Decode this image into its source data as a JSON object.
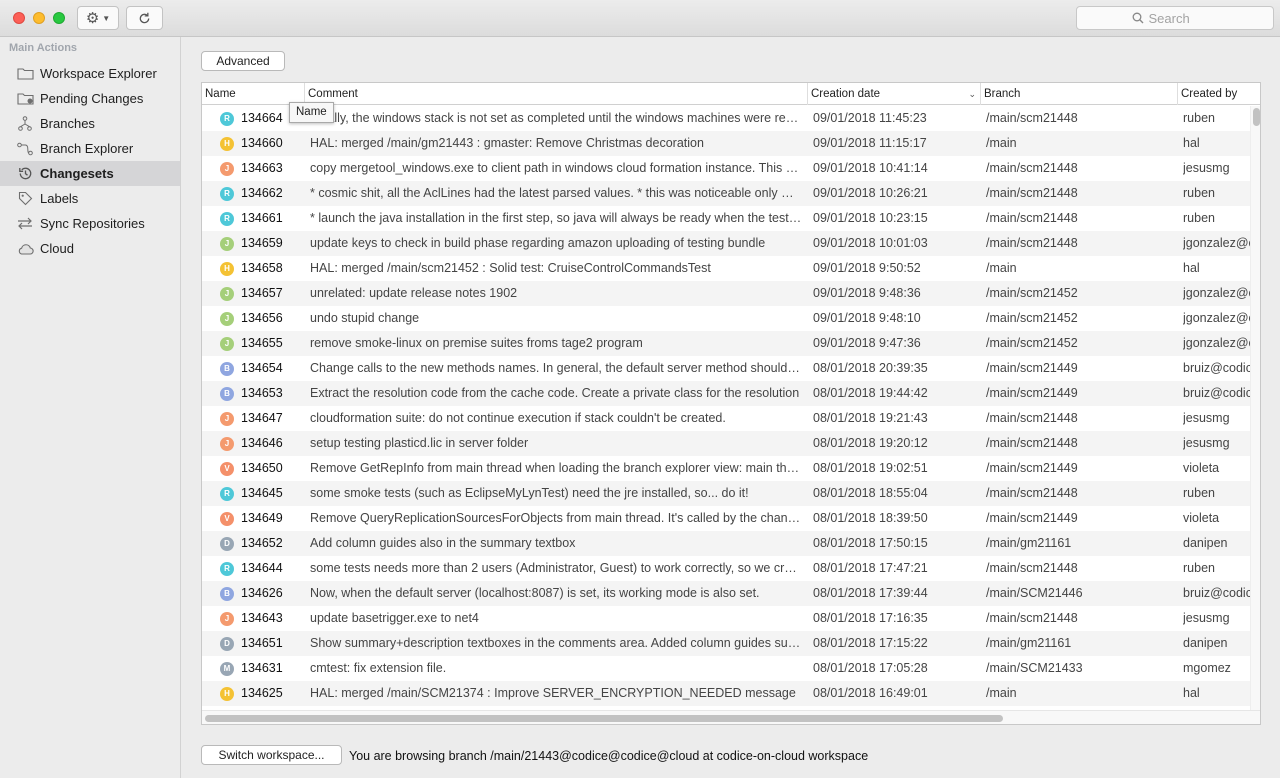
{
  "toolbar": {
    "search_placeholder": "Search",
    "gear_icon": "gear-icon",
    "refresh_icon": "refresh-icon"
  },
  "sidebar": {
    "header": "Main Actions",
    "items": [
      {
        "label": "Workspace Explorer",
        "icon": "folder-icon",
        "selected": false
      },
      {
        "label": "Pending Changes",
        "icon": "pending-folder-icon",
        "selected": false
      },
      {
        "label": "Branches",
        "icon": "branches-icon",
        "selected": false
      },
      {
        "label": "Branch Explorer",
        "icon": "branch-explorer-icon",
        "selected": false
      },
      {
        "label": "Changesets",
        "icon": "history-icon",
        "selected": true
      },
      {
        "label": "Labels",
        "icon": "tag-icon",
        "selected": false
      },
      {
        "label": "Sync Repositories",
        "icon": "sync-icon",
        "selected": false
      },
      {
        "label": "Cloud",
        "icon": "cloud-icon",
        "selected": false
      }
    ]
  },
  "main": {
    "advanced_label": "Advanced",
    "switch_label": "Switch workspace...",
    "status": "You are browsing branch /main/21443@codice@codice@cloud at codice-on-cloud workspace",
    "tooltip": "Name",
    "columns": [
      "Name",
      "Comment",
      "Creation date",
      "Branch",
      "Created by"
    ],
    "rows": [
      {
        "initial": "R",
        "color": "#4ec8d8",
        "id": "134664",
        "comment": "Finally, the windows stack is not set as completed until the windows machines were ready",
        "date": "09/01/2018 11:45:23",
        "branch": "/main/scm21448",
        "author": "ruben"
      },
      {
        "initial": "H",
        "color": "#f4c234",
        "id": "134660",
        "comment": "HAL: merged /main/gm21443 : gmaster: Remove Christmas decoration",
        "date": "09/01/2018 11:15:17",
        "branch": "/main",
        "author": "hal"
      },
      {
        "initial": "J",
        "color": "#f49a6e",
        "id": "134663",
        "comment": "copy mergetool_windows.exe to client path in windows cloud formation instance. This way",
        "date": "09/01/2018 10:41:14",
        "branch": "/main/scm21448",
        "author": "jesusmg"
      },
      {
        "initial": "R",
        "color": "#4ec8d8",
        "id": "134662",
        "comment": "* cosmic shit, all the AclLines had the latest parsed values. * this was  noticeable only when",
        "date": "09/01/2018 10:26:21",
        "branch": "/main/scm21448",
        "author": "ruben"
      },
      {
        "initial": "R",
        "color": "#4ec8d8",
        "id": "134661",
        "comment": "* launch the java installation in the first step, so java will always be ready when the tests start",
        "date": "09/01/2018 10:23:15",
        "branch": "/main/scm21448",
        "author": "ruben"
      },
      {
        "initial": "J",
        "color": "#a5cf7a",
        "id": "134659",
        "comment": "update keys to check in build phase regarding amazon uploading of testing bundle",
        "date": "09/01/2018 10:01:03",
        "branch": "/main/scm21448",
        "author": "jgonzalez@codice"
      },
      {
        "initial": "H",
        "color": "#f4c234",
        "id": "134658",
        "comment": "HAL: merged /main/scm21452 : Solid test: CruiseControlCommandsTest",
        "date": "09/01/2018 9:50:52",
        "branch": "/main",
        "author": "hal"
      },
      {
        "initial": "J",
        "color": "#a5cf7a",
        "id": "134657",
        "comment": "unrelated: update release notes 1902",
        "date": "09/01/2018 9:48:36",
        "branch": "/main/scm21452",
        "author": "jgonzalez@codice"
      },
      {
        "initial": "J",
        "color": "#a5cf7a",
        "id": "134656",
        "comment": "undo stupid change",
        "date": "09/01/2018 9:48:10",
        "branch": "/main/scm21452",
        "author": "jgonzalez@codice"
      },
      {
        "initial": "J",
        "color": "#a5cf7a",
        "id": "134655",
        "comment": "remove smoke-linux on premise suites froms tage2 program",
        "date": "09/01/2018 9:47:36",
        "branch": "/main/scm21452",
        "author": "jgonzalez@codice"
      },
      {
        "initial": "B",
        "color": "#8fa6e0",
        "id": "134654",
        "comment": "Change calls to the new methods names.  In general, the default server method should be used",
        "date": "08/01/2018 20:39:35",
        "branch": "/main/scm21449",
        "author": "bruiz@codice"
      },
      {
        "initial": "B",
        "color": "#8fa6e0",
        "id": "134653",
        "comment": "Extract the resolution code from the cache code. Create a private class for the resolution",
        "date": "08/01/2018 19:44:42",
        "branch": "/main/scm21449",
        "author": "bruiz@codice"
      },
      {
        "initial": "J",
        "color": "#f49a6e",
        "id": "134647",
        "comment": "cloudformation suite: do not continue execution if stack couldn't be created.",
        "date": "08/01/2018 19:21:43",
        "branch": "/main/scm21448",
        "author": "jesusmg"
      },
      {
        "initial": "J",
        "color": "#f49a6e",
        "id": "134646",
        "comment": "setup testing plasticd.lic in server folder",
        "date": "08/01/2018 19:20:12",
        "branch": "/main/scm21448",
        "author": "jesusmg"
      },
      {
        "initial": "V",
        "color": "#f4906a",
        "id": "134650",
        "comment": "Remove GetRepInfo from main thread when loading the branch explorer view: main thread",
        "date": "08/01/2018 19:02:51",
        "branch": "/main/scm21449",
        "author": "violeta"
      },
      {
        "initial": "R",
        "color": "#4ec8d8",
        "id": "134645",
        "comment": "some smoke tests (such as EclipseMyLynTest) need the jre installed, so... do it!",
        "date": "08/01/2018 18:55:04",
        "branch": "/main/scm21448",
        "author": "ruben"
      },
      {
        "initial": "V",
        "color": "#f4906a",
        "id": "134649",
        "comment": "Remove QueryReplicationSourcesForObjects from main thread. It's called by the changes view",
        "date": "08/01/2018 18:39:50",
        "branch": "/main/scm21449",
        "author": "violeta"
      },
      {
        "initial": "D",
        "color": "#98a6b4",
        "id": "134652",
        "comment": "Add column guides also in the summary textbox",
        "date": "08/01/2018 17:50:15",
        "branch": "/main/gm21161",
        "author": "danipen"
      },
      {
        "initial": "R",
        "color": "#4ec8d8",
        "id": "134644",
        "comment": "some tests needs more than 2 users (Administrator, Guest) to work correctly, so we create them",
        "date": "08/01/2018 17:47:21",
        "branch": "/main/scm21448",
        "author": "ruben"
      },
      {
        "initial": "B",
        "color": "#8fa6e0",
        "id": "134626",
        "comment": "Now, when the default server (localhost:8087) is set, its working mode is also set.",
        "date": "08/01/2018 17:39:44",
        "branch": "/main/SCM21446",
        "author": "bruiz@codice"
      },
      {
        "initial": "J",
        "color": "#f49a6e",
        "id": "134643",
        "comment": "update basetrigger.exe to net4",
        "date": "08/01/2018 17:16:35",
        "branch": "/main/scm21448",
        "author": "jesusmg"
      },
      {
        "initial": "D",
        "color": "#98a6b4",
        "id": "134651",
        "comment": "Show summary+description textboxes in the comments area. Added column guides support",
        "date": "08/01/2018 17:15:22",
        "branch": "/main/gm21161",
        "author": "danipen"
      },
      {
        "initial": "M",
        "color": "#98a6b4",
        "id": "134631",
        "comment": "cmtest: fix extension file.",
        "date": "08/01/2018 17:05:28",
        "branch": "/main/SCM21433",
        "author": "mgomez"
      },
      {
        "initial": "H",
        "color": "#f4c234",
        "id": "134625",
        "comment": "HAL: merged /main/SCM21374 : Improve SERVER_ENCRYPTION_NEEDED message",
        "date": "08/01/2018 16:49:01",
        "branch": "/main",
        "author": "hal"
      }
    ]
  }
}
